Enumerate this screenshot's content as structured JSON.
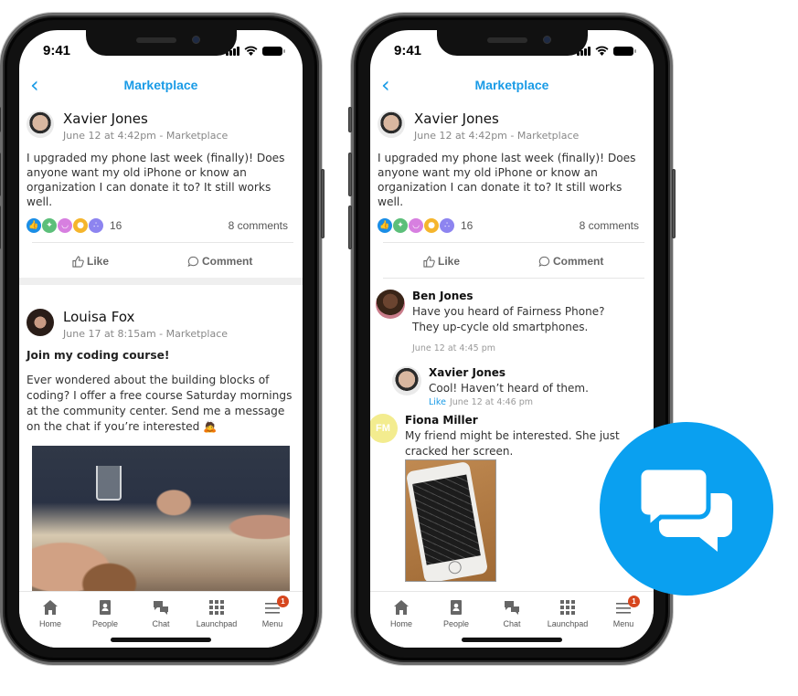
{
  "status_bar": {
    "time": "9:41"
  },
  "nav": {
    "back_icon": "chevron-left-icon",
    "title": "Marketplace"
  },
  "post": {
    "author": "Xavier Jones",
    "meta": "June 12 at 4:42pm - Marketplace",
    "text": "I upgraded my phone last week (finally)! Does anyone want my old iPhone or know an organization I can donate it to? It still works well.",
    "reactions": [
      {
        "icon": "thumbs-up-icon",
        "color": "#1a8ee6"
      },
      {
        "icon": "party-popper-icon",
        "color": "#5cbf7a"
      },
      {
        "icon": "smile-icon",
        "color": "#d77fe0"
      },
      {
        "icon": "lightbulb-icon",
        "color": "#f5b52c"
      },
      {
        "icon": "network-icon",
        "color": "#8d84f0"
      }
    ],
    "reaction_count": "16",
    "comment_count": "8 comments",
    "like_label": "Like",
    "comment_label": "Comment"
  },
  "post2": {
    "author": "Louisa Fox",
    "meta": "June 17 at 8:15am - Marketplace",
    "title": "Join my coding course!",
    "text": "Ever wondered about the building blocks of coding? I offer a free course Saturday mornings at the community center. Send me a message on the chat if you’re interested 🙇"
  },
  "comments": [
    {
      "author": "Ben Jones",
      "text": "Have you heard of Fairness Phone? They up-cycle old smartphones.",
      "time": "June 12 at 4:45 pm"
    },
    {
      "author": "Xavier Jones",
      "text": "Cool! Haven’t heard of them.",
      "like_label": "Like",
      "time": "June 12 at 4:46 pm"
    },
    {
      "author": "Fiona Miller",
      "initials": "FM",
      "text": "My friend might be interested. She just cracked her screen."
    }
  ],
  "tabbar": [
    {
      "label": "Home",
      "icon": "home-icon"
    },
    {
      "label": "People",
      "icon": "contacts-icon"
    },
    {
      "label": "Chat",
      "icon": "chat-icon"
    },
    {
      "label": "Launchpad",
      "icon": "grid-icon"
    },
    {
      "label": "Menu",
      "icon": "menu-icon",
      "badge": "1"
    }
  ],
  "colors": {
    "accent": "#1a9be6",
    "badge": "#d6461e",
    "chat_circle": "#0aa0f0"
  }
}
